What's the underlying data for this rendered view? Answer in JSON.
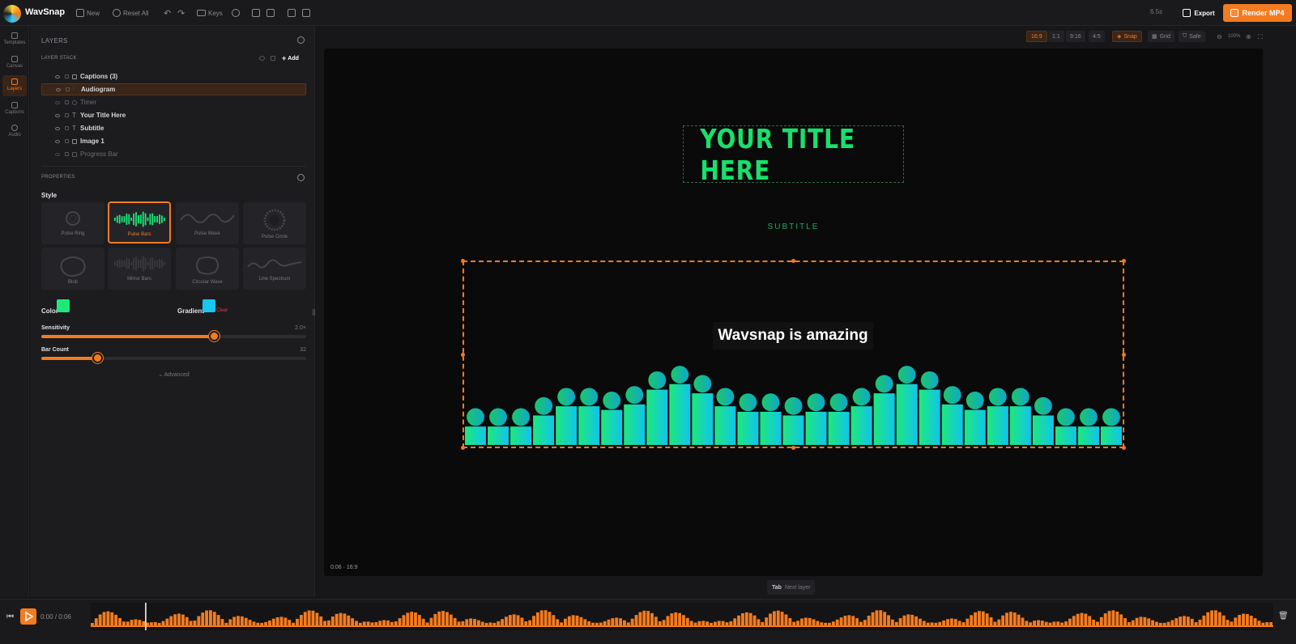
{
  "app": {
    "name": "WavSnap"
  },
  "toolbar": {
    "new_label": "New",
    "reset_label": "Reset All",
    "keys_label": "Keys",
    "duration": "6.5s",
    "export_label": "Export",
    "render_label": "Render MP4",
    "icons": [
      "undo-icon",
      "redo-icon",
      "keyboard-icon",
      "help-icon",
      "save-icon",
      "folder-icon",
      "panel-icon",
      "fullscreen-icon"
    ]
  },
  "rail": {
    "items": [
      {
        "label": "Templates",
        "icon": "template-icon"
      },
      {
        "label": "Canvas",
        "icon": "image-icon"
      },
      {
        "label": "Layers",
        "icon": "layers-icon",
        "active": true
      },
      {
        "label": "Captions",
        "icon": "captions-icon"
      },
      {
        "label": "Audio",
        "icon": "music-icon"
      }
    ]
  },
  "layers": {
    "header": "LAYERS",
    "stack_label": "LAYER STACK",
    "add_label": "Add",
    "items": [
      {
        "name": "Captions (3)",
        "visible": true
      },
      {
        "name": "Audiogram",
        "visible": true,
        "selected": true
      },
      {
        "name": "Timer",
        "visible": false
      },
      {
        "name": "Your Title Here",
        "visible": true
      },
      {
        "name": "Subtitle",
        "visible": true
      },
      {
        "name": "Image 1",
        "visible": true
      },
      {
        "name": "Progress Bar",
        "visible": false
      }
    ]
  },
  "properties": {
    "header": "PROPERTIES",
    "style_label": "Style",
    "styles": [
      {
        "name": "Pulse Ring"
      },
      {
        "name": "Pulse Bars",
        "active": true
      },
      {
        "name": "Pulse Wave"
      },
      {
        "name": "Pulse Circle"
      },
      {
        "name": "Blob"
      },
      {
        "name": "Mirror Bars"
      },
      {
        "name": "Circular Wave"
      },
      {
        "name": "Line Spectrum"
      }
    ],
    "color_label": "Color",
    "color_value": "#1ee87a",
    "gradient_label": "Gradient",
    "gradient_value": "#18c6f0",
    "clear_label": "Clear",
    "sensitivity_label": "Sensitivity",
    "sensitivity_value": "2.0×",
    "sensitivity_fraction": 0.65,
    "barcount_label": "Bar Count",
    "barcount_value": "32",
    "barcount_fraction": 0.21,
    "advanced_label": "Advanced"
  },
  "canvas": {
    "aspects": [
      {
        "label": "16:9",
        "active": true
      },
      {
        "label": "1:1"
      },
      {
        "label": "9:16"
      },
      {
        "label": "4:5"
      }
    ],
    "snap_label": "Snap",
    "grid_label": "Grid",
    "safe_label": "Safe",
    "zoom": "100%",
    "title_text": "YOUR TITLE HERE",
    "subtitle_text": "SUBTITLE",
    "caption_text": "Wavsnap is amazing",
    "stage_info": "0:06 · 16:9",
    "tab_key": "Tab",
    "tab_hint": "Next layer",
    "bar_levels": [
      0.1,
      0.1,
      0.1,
      0.16,
      0.21,
      0.21,
      0.19,
      0.22,
      0.3,
      0.33,
      0.28,
      0.21,
      0.18,
      0.18,
      0.16,
      0.18,
      0.18,
      0.21,
      0.28,
      0.33,
      0.3,
      0.22,
      0.19,
      0.21,
      0.21,
      0.16,
      0.1,
      0.1,
      0.1
    ],
    "accent": "#f47b20",
    "bar_start": "#1ee87a",
    "bar_end": "#0fc4ee"
  },
  "timeline": {
    "current": "0:00",
    "total": "0:06",
    "separator": "/",
    "playhead_fraction": 0.046
  }
}
